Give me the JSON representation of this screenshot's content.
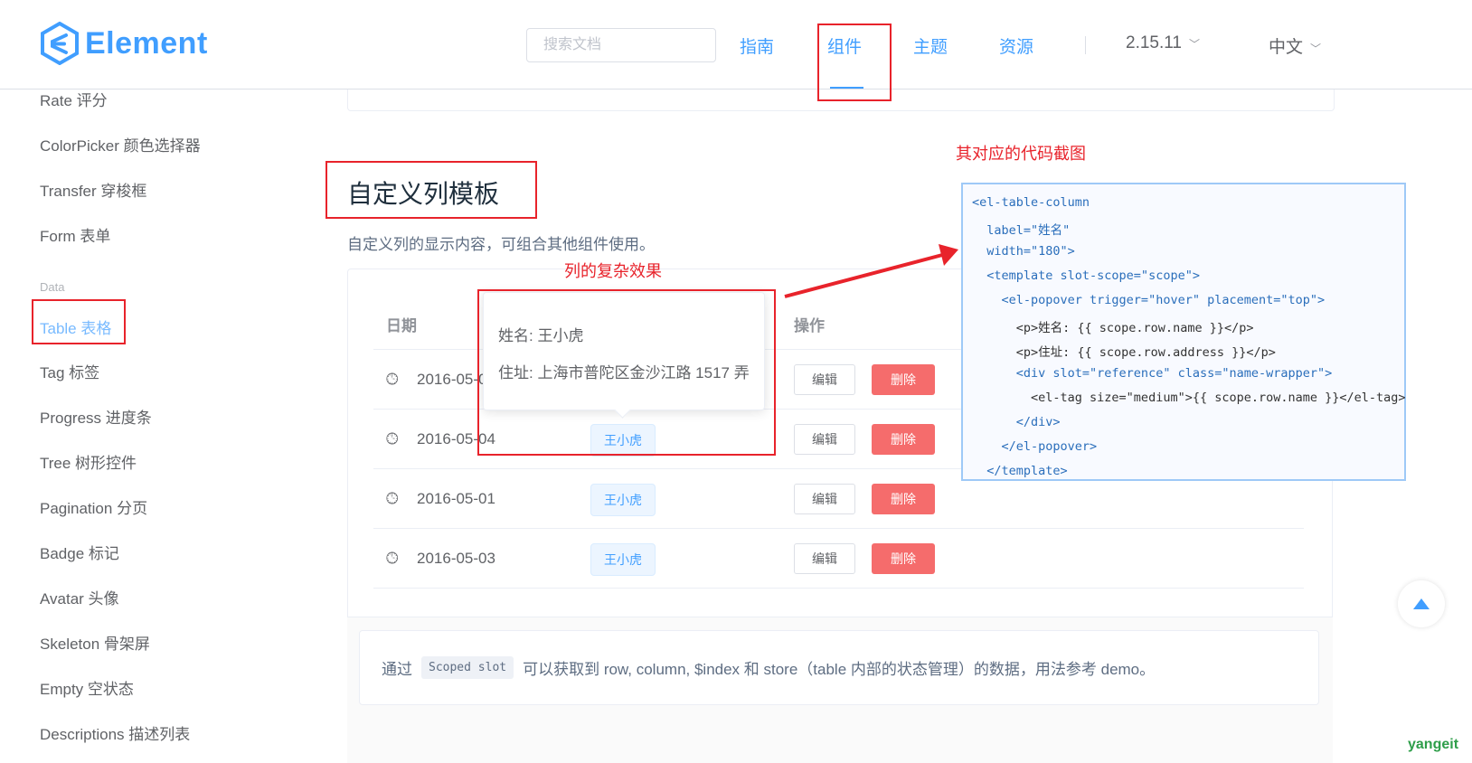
{
  "header": {
    "logo_text": "Element",
    "search_placeholder": "搜索文档",
    "nav": [
      "指南",
      "组件",
      "主题",
      "资源"
    ],
    "version": "2.15.11",
    "language": "中文",
    "accent_color": "#409eff"
  },
  "sidebar": {
    "items_top": [
      "Rate 评分",
      "ColorPicker 颜色选择器",
      "Transfer 穿梭框",
      "Form 表单"
    ],
    "group": "Data",
    "active_item": "Table 表格",
    "items_bottom": [
      "Tag 标签",
      "Progress 进度条",
      "Tree 树形控件",
      "Pagination 分页",
      "Badge 标记",
      "Avatar 头像",
      "Skeleton 骨架屏",
      "Empty 空状态",
      "Descriptions 描述列表"
    ]
  },
  "content": {
    "title": "自定义列模板",
    "description": "自定义列的显示内容，可组合其他组件使用。",
    "table": {
      "headers": {
        "date": "日期",
        "actions": "操作"
      },
      "rows": [
        {
          "date": "2016-05-02",
          "name": "王小虎"
        },
        {
          "date": "2016-05-04",
          "name": "王小虎"
        },
        {
          "date": "2016-05-01",
          "name": "王小虎"
        },
        {
          "date": "2016-05-03",
          "name": "王小虎"
        }
      ],
      "edit_label": "编辑",
      "delete_label": "删除"
    },
    "popover": {
      "name_line": "姓名: 王小虎",
      "address_line": "住址: 上海市普陀区金沙江路 1517 弄"
    },
    "meta_description": {
      "prefix": "通过",
      "code": "Scoped slot",
      "suffix": "可以获取到 row, column, $index 和 store（table 内部的状态管理）的数据，用法参考 demo。"
    }
  },
  "annotations": {
    "popover_label": "列的复杂效果",
    "code_label": "其对应的代码截图",
    "color": "#e8232b"
  },
  "code_snapshot": [
    "<el-table-column",
    "  label=\"姓名\"",
    "  width=\"180\">",
    "  <template slot-scope=\"scope\">",
    "    <el-popover trigger=\"hover\" placement=\"top\">",
    "      <p>姓名: {{ scope.row.name }}</p>",
    "      <p>住址: {{ scope.row.address }}</p>",
    "      <div slot=\"reference\" class=\"name-wrapper\">",
    "        <el-tag size=\"medium\">{{ scope.row.name }}</el-tag>",
    "      </div>",
    "    </el-popover>",
    "  </template>"
  ],
  "watermark": "yangeit"
}
